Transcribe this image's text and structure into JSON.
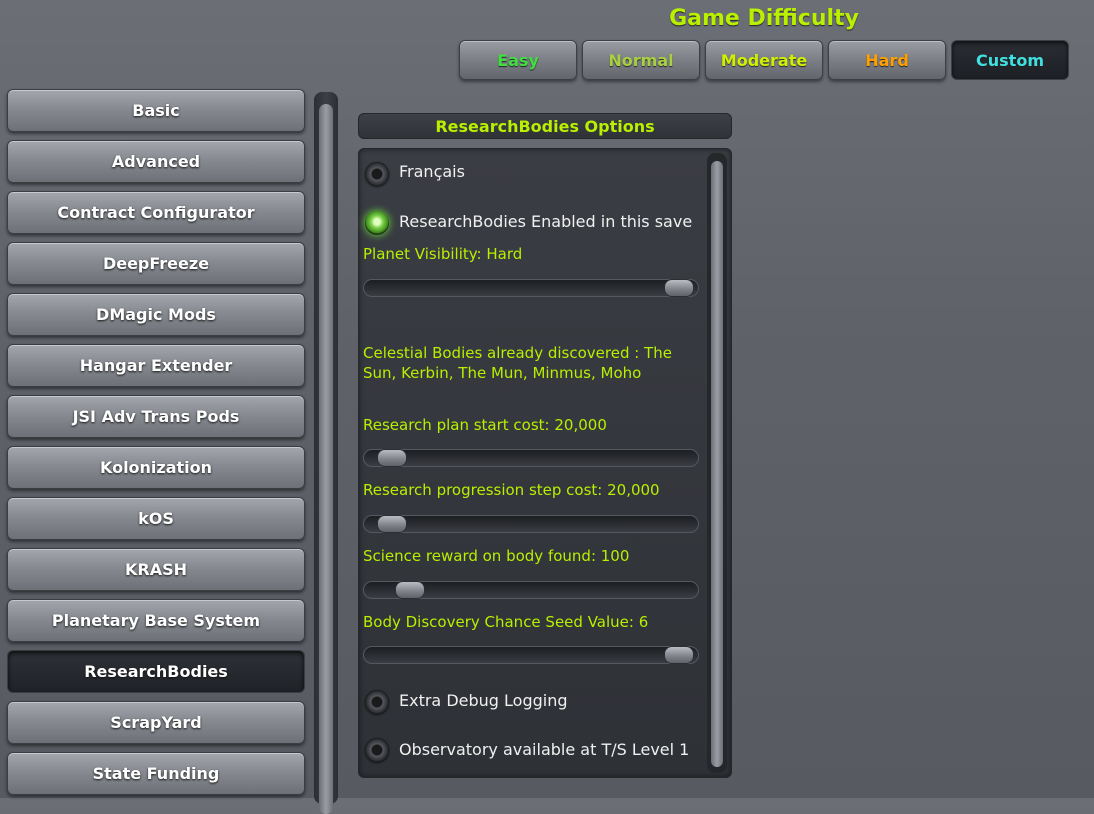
{
  "header": {
    "title": "Game Difficulty"
  },
  "difficulty": [
    {
      "label": "Easy",
      "color": "#3fe040",
      "active": false
    },
    {
      "label": "Normal",
      "color": "#a8d040",
      "active": false
    },
    {
      "label": "Moderate",
      "color": "#d0f000",
      "active": false
    },
    {
      "label": "Hard",
      "color": "#ffa000",
      "active": false
    },
    {
      "label": "Custom",
      "color": "#40e0e0",
      "active": true
    }
  ],
  "sidebar": {
    "items": [
      {
        "label": "Basic"
      },
      {
        "label": "Advanced"
      },
      {
        "label": "Contract Configurator"
      },
      {
        "label": "DeepFreeze"
      },
      {
        "label": "DMagic Mods"
      },
      {
        "label": "Hangar Extender"
      },
      {
        "label": "JSI Adv Trans Pods"
      },
      {
        "label": "Kolonization"
      },
      {
        "label": "kOS"
      },
      {
        "label": "KRASH"
      },
      {
        "label": "Planetary Base System"
      },
      {
        "label": "ResearchBodies",
        "active": true
      },
      {
        "label": "ScrapYard"
      },
      {
        "label": "State Funding"
      }
    ]
  },
  "panel": {
    "title": "ResearchBodies Options",
    "toggle_francais": {
      "label": "Français",
      "on": false
    },
    "toggle_enabled": {
      "label": "ResearchBodies Enabled in this save",
      "on": true
    },
    "planet_visibility": {
      "label": "Planet Visibility: Hard",
      "level": 1.0
    },
    "discovered": {
      "label": "Celestial Bodies already discovered : The Sun, Kerbin, The Mun, Minmus, Moho"
    },
    "start_cost": {
      "label": "Research plan start cost: 20,000",
      "level": 0.03
    },
    "step_cost": {
      "label": "Research progression step cost: 20,000",
      "level": 0.03
    },
    "science_reward": {
      "label": "Science reward on body found: 100",
      "level": 0.09
    },
    "seed_value": {
      "label": "Body Discovery Chance Seed Value: 6",
      "level": 1.0
    },
    "toggle_debug": {
      "label": "Extra Debug Logging",
      "on": false
    },
    "toggle_observatory": {
      "label": "Observatory available at T/S Level 1",
      "on": false
    }
  },
  "colors": {
    "accent": "#b8f000"
  }
}
